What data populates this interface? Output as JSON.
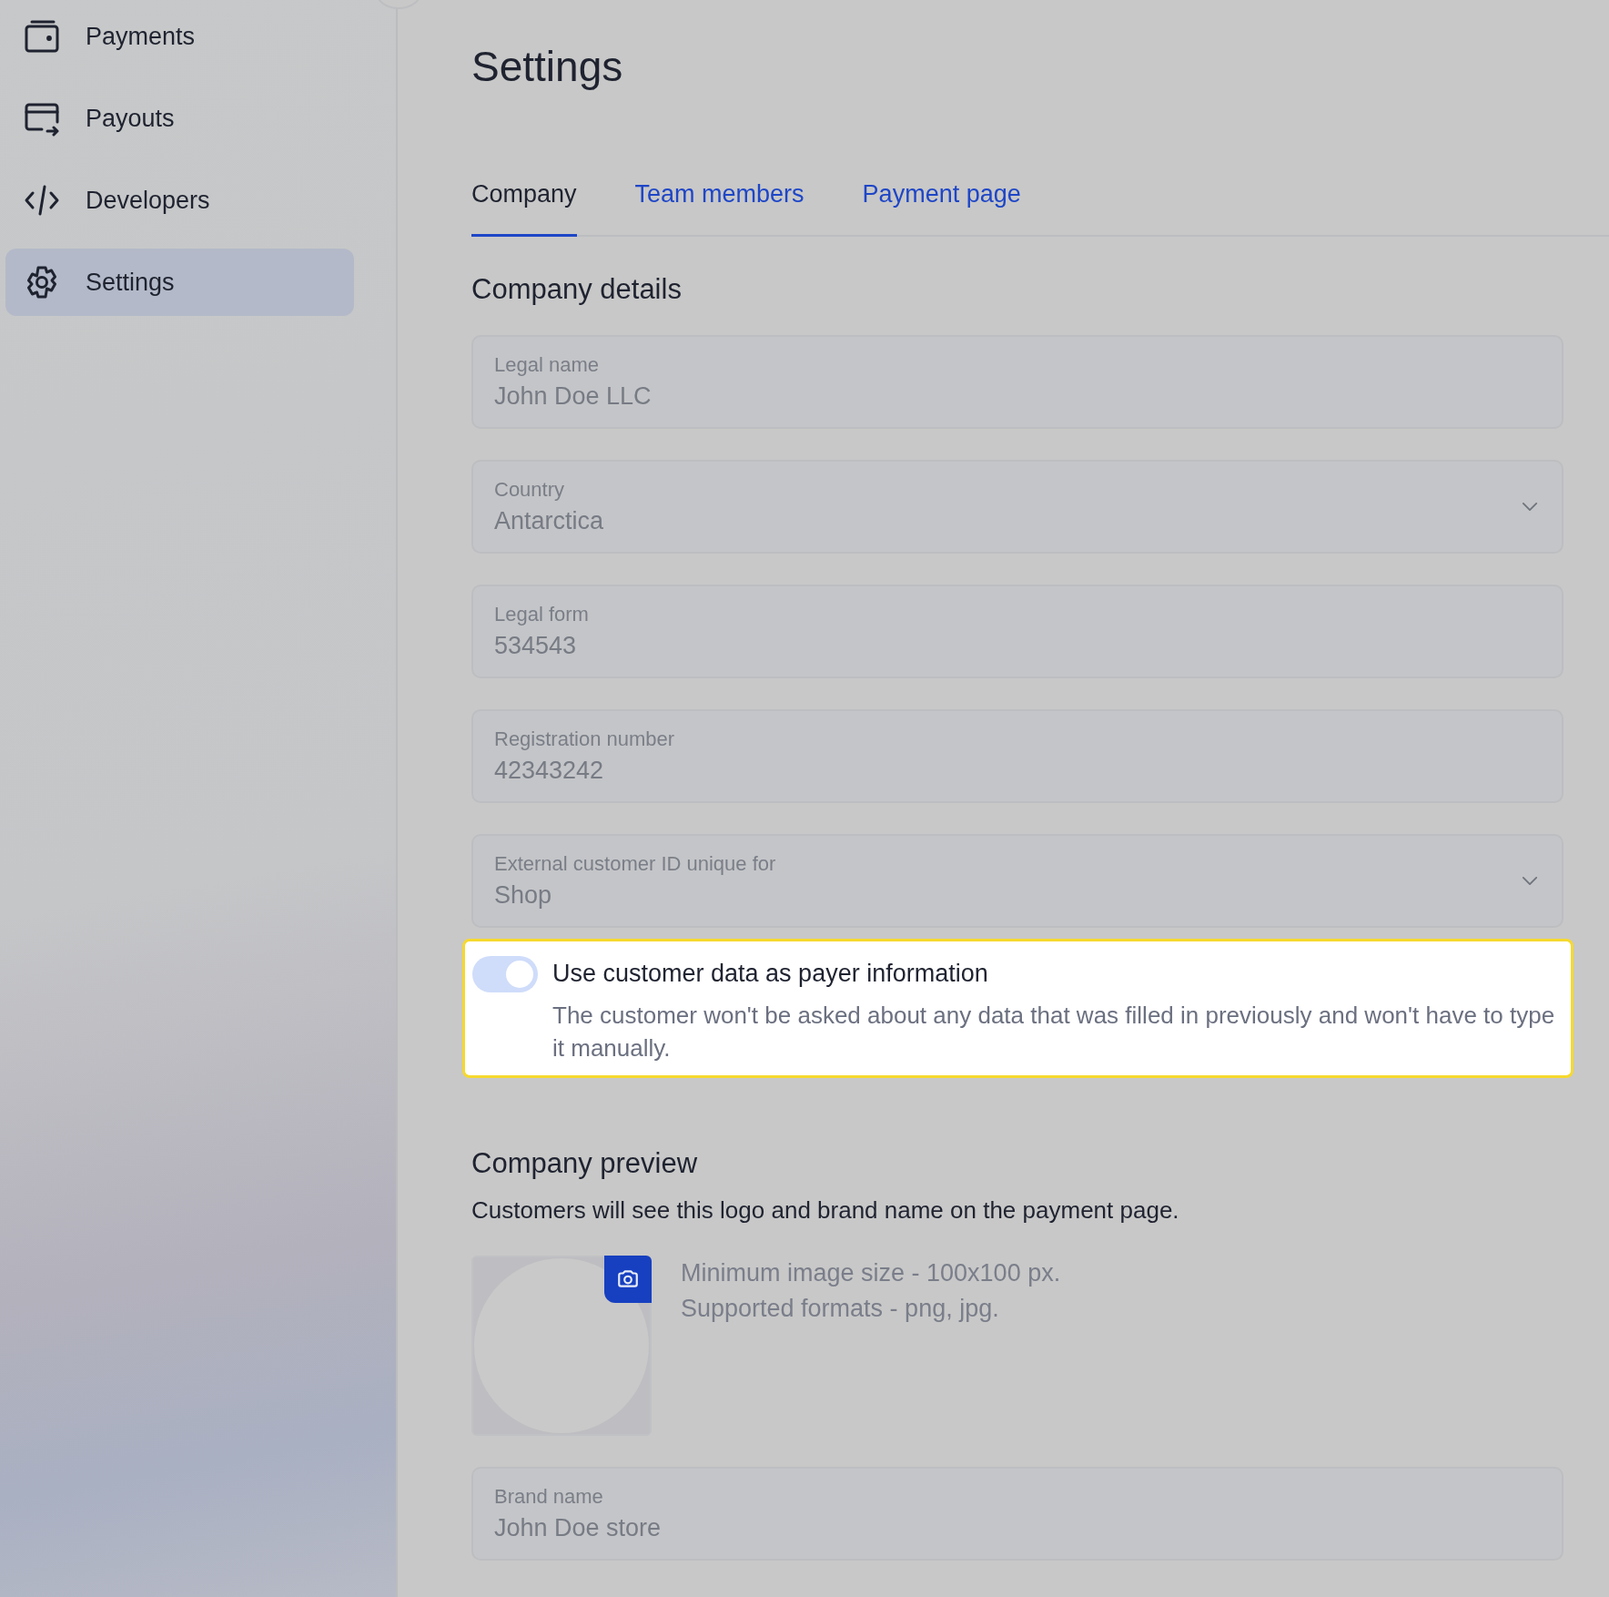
{
  "sidebar": {
    "items": [
      {
        "label": "Payments",
        "selected": false
      },
      {
        "label": "Payouts",
        "selected": false
      },
      {
        "label": "Developers",
        "selected": false
      },
      {
        "label": "Settings",
        "selected": true
      }
    ]
  },
  "page": {
    "title": "Settings"
  },
  "tabs": [
    {
      "label": "Company",
      "selected": true
    },
    {
      "label": "Team members",
      "selected": false
    },
    {
      "label": "Payment page",
      "selected": false
    }
  ],
  "company_details": {
    "heading": "Company details",
    "fields": [
      {
        "kind": "text",
        "label": "Legal name",
        "value": "John Doe LLC"
      },
      {
        "kind": "select",
        "label": "Country",
        "value": "Antarctica"
      },
      {
        "kind": "text",
        "label": "Legal form",
        "value": "534543"
      },
      {
        "kind": "text",
        "label": "Registration number",
        "value": "42343242"
      },
      {
        "kind": "select",
        "label": "External customer ID unique for",
        "value": "Shop"
      }
    ]
  },
  "payer_toggle": {
    "on": true,
    "label": "Use customer data as payer information",
    "description": "The customer won't be asked about any data that was filled in previously and won't have to type it manually."
  },
  "company_preview": {
    "heading": "Company preview",
    "description": "Customers will see this logo and brand name on the payment page.",
    "hints": [
      "Minimum image size - 100x100 px.",
      "Supported formats - png, jpg."
    ],
    "brand_field": {
      "label": "Brand name",
      "value": "John Doe store"
    }
  }
}
